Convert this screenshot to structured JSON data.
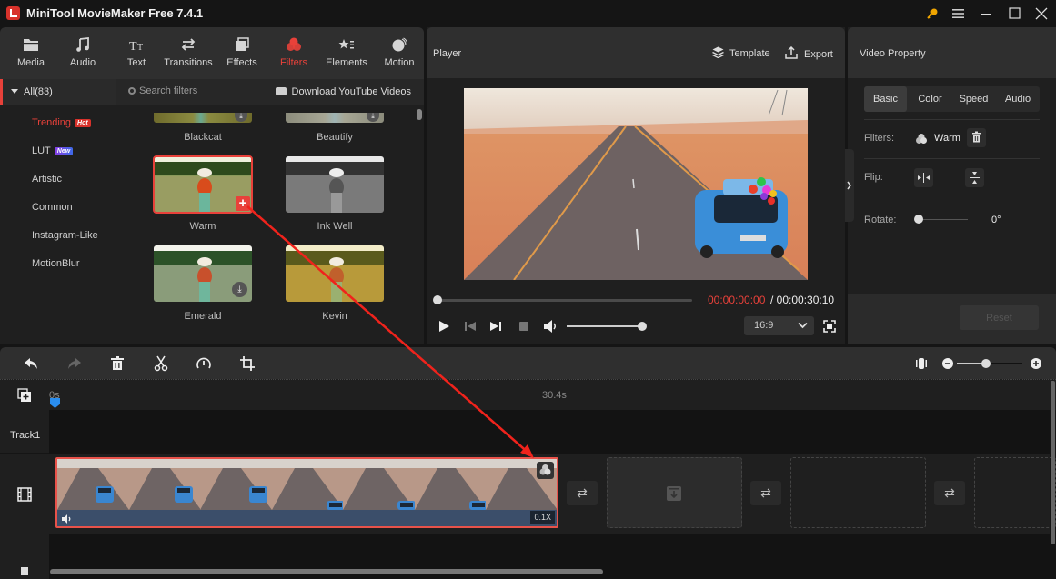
{
  "app": {
    "title": "MiniTool MovieMaker Free 7.4.1",
    "accent_color": "#e8413a"
  },
  "window_controls": [
    "key-icon",
    "menu-icon",
    "minimize-icon",
    "maximize-icon",
    "close-icon"
  ],
  "toolbar": {
    "items": [
      {
        "label": "Media",
        "icon": "folder-icon"
      },
      {
        "label": "Audio",
        "icon": "music-note-icon"
      },
      {
        "label": "Text",
        "icon": "text-icon"
      },
      {
        "label": "Transitions",
        "icon": "transition-arrows-icon"
      },
      {
        "label": "Effects",
        "icon": "effects-icon"
      },
      {
        "label": "Filters",
        "icon": "filters-icon",
        "active": true
      },
      {
        "label": "Elements",
        "icon": "elements-icon"
      },
      {
        "label": "Motion",
        "icon": "motion-icon"
      }
    ]
  },
  "categories": {
    "all_label": "All(83)",
    "items": [
      {
        "label": "Trending",
        "badge": "Hot",
        "badge_color": "#d8322b",
        "active": true
      },
      {
        "label": "LUT",
        "badge": "New",
        "badge_color": "#7b3fe4"
      },
      {
        "label": "Artistic"
      },
      {
        "label": "Common"
      },
      {
        "label": "Instagram-Like"
      },
      {
        "label": "MotionBlur"
      }
    ]
  },
  "filters": {
    "search_placeholder": "Search filters",
    "youtube_link": "Download YouTube Videos",
    "items": [
      {
        "name": "Blackcat",
        "state": "download"
      },
      {
        "name": "Beautify",
        "state": "download"
      },
      {
        "name": "Warm",
        "state": "selected"
      },
      {
        "name": "Ink Well",
        "state": "downloaded"
      },
      {
        "name": "Emerald",
        "state": "download"
      },
      {
        "name": "Kevin",
        "state": "downloaded"
      }
    ]
  },
  "player": {
    "title": "Player",
    "template_label": "Template",
    "export_label": "Export",
    "time_current": "00:00:00:00",
    "time_separator": " / ",
    "time_total": "00:00:30:10",
    "progress": 0,
    "volume": 1.0,
    "aspect_ratio": "16:9"
  },
  "property": {
    "title": "Video Property",
    "tabs": [
      "Basic",
      "Color",
      "Speed",
      "Audio"
    ],
    "active_tab": "Basic",
    "filters_label": "Filters:",
    "filter_value": "Warm",
    "flip_label": "Flip:",
    "rotate_label": "Rotate:",
    "rotate_value": "0°",
    "reset_label": "Reset"
  },
  "timeline": {
    "tools": [
      "undo-icon",
      "redo-icon",
      "delete-icon",
      "split-icon",
      "speed-icon",
      "crop-icon"
    ],
    "zoom_level": 0.5,
    "ruler": {
      "start": "0s",
      "mark": "30.4s"
    },
    "track_label": "Track1",
    "clip": {
      "speed": "0.1X",
      "filter": "Warm"
    }
  }
}
